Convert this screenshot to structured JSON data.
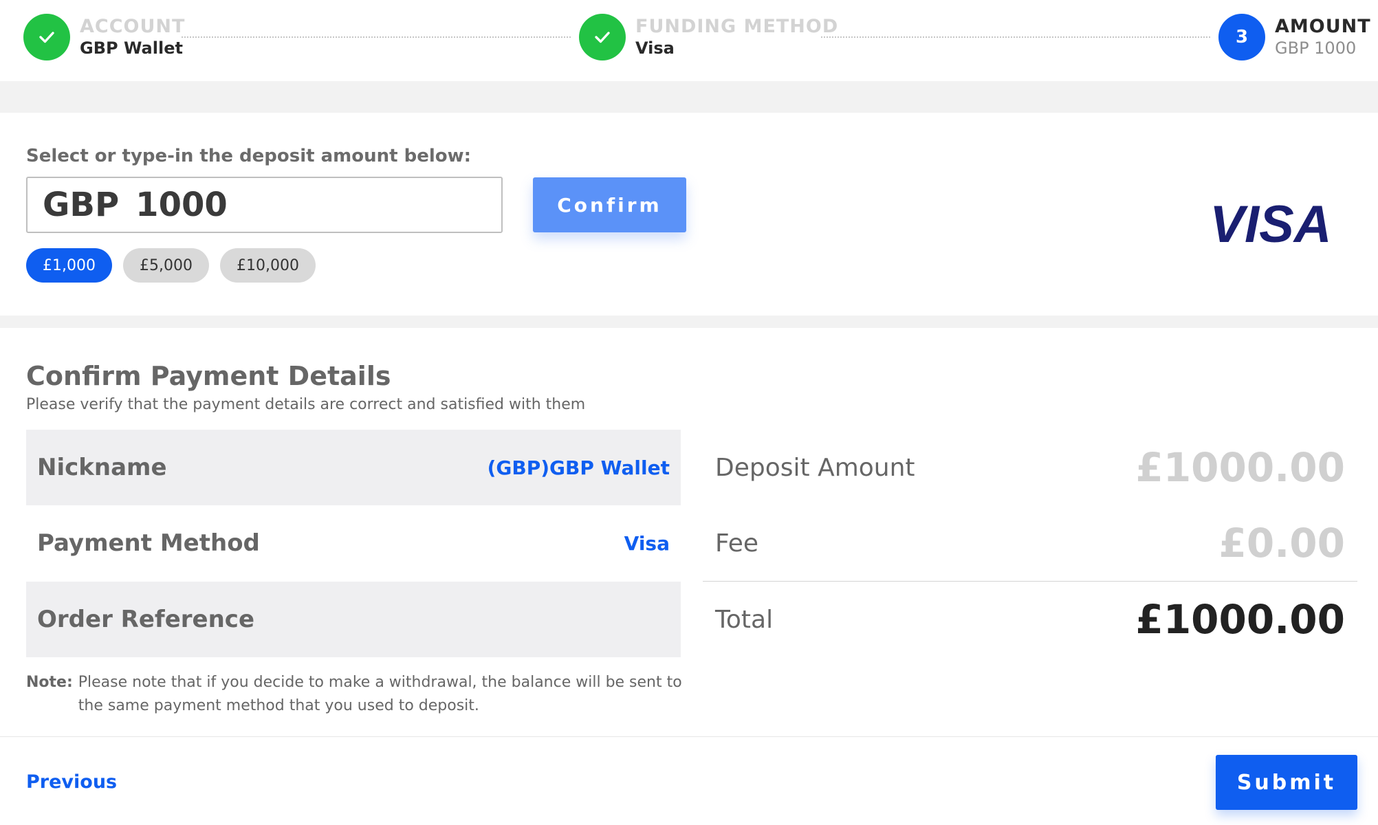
{
  "stepper": {
    "steps": [
      {
        "title": "ACCOUNT",
        "subtitle": "GBP Wallet",
        "status": "complete"
      },
      {
        "title": "FUNDING METHOD",
        "subtitle": "Visa",
        "status": "complete"
      },
      {
        "title": "AMOUNT",
        "subtitle": "GBP 1000",
        "status": "active",
        "number": "3"
      }
    ]
  },
  "amount": {
    "label": "Select or type-in the deposit amount below:",
    "currency": "GBP",
    "value": "1000",
    "confirm_label": "Confirm",
    "presets": [
      {
        "label": "£1,000",
        "selected": true
      },
      {
        "label": "£5,000",
        "selected": false
      },
      {
        "label": "£10,000",
        "selected": false
      }
    ],
    "card_brand": "VISA"
  },
  "details": {
    "title": "Confirm Payment Details",
    "subtitle": "Please verify that the payment details are correct and satisfied with them",
    "rows": [
      {
        "label": "Nickname",
        "value": "(GBP)GBP Wallet"
      },
      {
        "label": "Payment Method",
        "value": "Visa"
      },
      {
        "label": "Order Reference",
        "value": ""
      }
    ],
    "summary": [
      {
        "label": "Deposit Amount",
        "value": "£1000.00"
      },
      {
        "label": "Fee",
        "value": "£0.00"
      },
      {
        "label": "Total",
        "value": "£1000.00"
      }
    ],
    "note_label": "Note:",
    "note_text": "Please note that if you decide to make a withdrawal, the balance will be sent to the same payment method that you used to deposit."
  },
  "footer": {
    "previous_label": "Previous",
    "submit_label": "Submit"
  },
  "colors": {
    "primary": "#0f5ef0",
    "success": "#22c244",
    "confirm_button": "#5b92f8",
    "visa_blue": "#1a1f71"
  }
}
